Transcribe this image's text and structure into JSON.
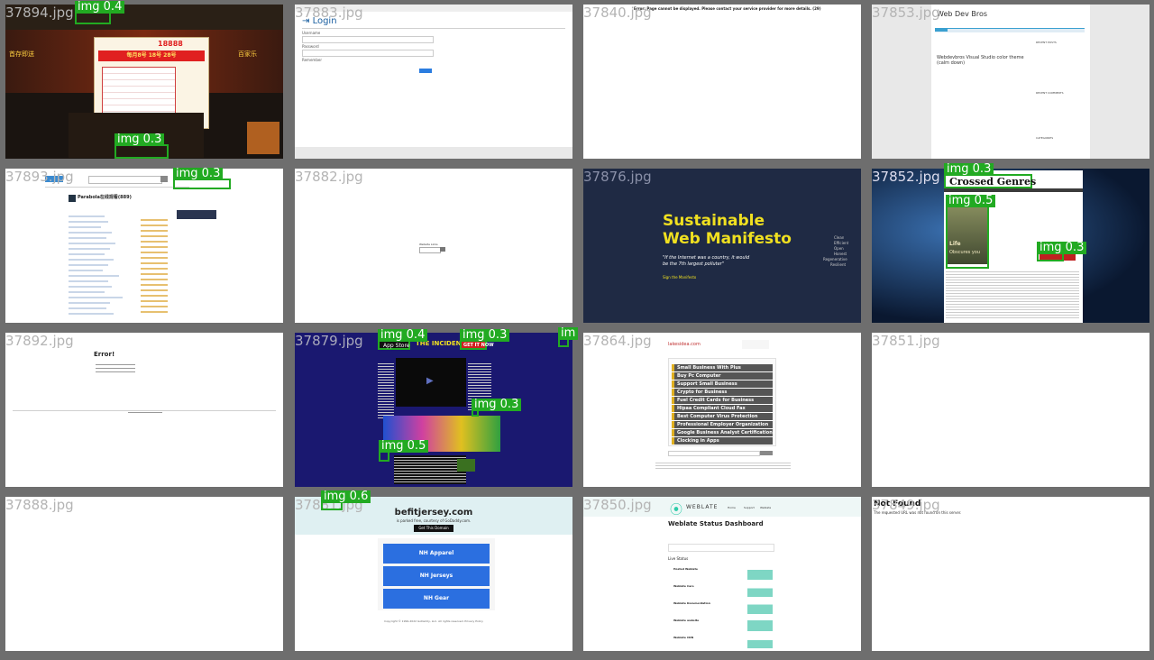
{
  "tiles": [
    {
      "filename": "37894.jpg",
      "detections": [
        {
          "label": "img 0.4"
        },
        {
          "label": "img 0.3"
        }
      ],
      "content": {
        "banner": "每月8号 18号 28号",
        "amount": "18888",
        "left_text": "首存即送",
        "right_text": "百家乐"
      }
    },
    {
      "filename": "37883.jpg",
      "detections": [],
      "content": {
        "title": "Login",
        "field1": "Username",
        "field2": "Password",
        "field3": "Remember"
      }
    },
    {
      "filename": "37840.jpg",
      "detections": [],
      "content": {
        "error": "Error: Page cannot be displayed. Please contact your service provider for more details. (29)"
      }
    },
    {
      "filename": "37853.jpg",
      "detections": [],
      "content": {
        "site_title": "Web Dev Bros",
        "post_title": "Webdevbros Visual Studio color theme (calm down)",
        "sidebar1": "RECENT POSTS",
        "sidebar2": "RECENT COMMENTS",
        "sidebar3": "CATEGORIES"
      }
    },
    {
      "filename": "37893.jpg",
      "detections": [
        {
          "label": "img 0.3"
        }
      ],
      "content": {
        "page_title": "Parabola在线观看(889)"
      }
    },
    {
      "filename": "37882.jpg",
      "detections": [],
      "content": {
        "box_label": "Website Links"
      }
    },
    {
      "filename": "37876.jpg",
      "detections": [],
      "content": {
        "headline_line1": "Sustainable",
        "headline_line2": "Web Manifesto",
        "quote": "\"If the Internet was a country, it would be the 7th largest polluter\"",
        "sign": "Sign the Manifesto",
        "list": [
          "Clean",
          "Efficient",
          "Open",
          "Honest",
          "Regenerative",
          "Resilient"
        ]
      }
    },
    {
      "filename": "37852.jpg",
      "detections": [
        {
          "label": "img 0.3"
        },
        {
          "label": "img 0.5"
        },
        {
          "label": "img 0.3"
        }
      ],
      "content": {
        "logo": "Crossed Genres",
        "book_line1": "Life",
        "book_line2": "Obscures you"
      }
    },
    {
      "filename": "37892.jpg",
      "detections": [],
      "content": {
        "title": "Error!"
      }
    },
    {
      "filename": "37879.jpg",
      "detections": [
        {
          "label": "img 0.4"
        },
        {
          "label": "img 0.3"
        },
        {
          "label": "im"
        },
        {
          "label": "img 0.3"
        },
        {
          "label": "img 0.5"
        }
      ],
      "content": {
        "app_store": "App Store",
        "incident": "THE INCIDENT",
        "get_it": "GET IT NOW"
      }
    },
    {
      "filename": "37864.jpg",
      "detections": [],
      "content": {
        "site": "lakesidea.com",
        "links": [
          "Small Business With Plus",
          "Buy Pc Computer",
          "Support Small Business",
          "Crypto for Business",
          "Fuel Credit Cards for Business",
          "Hipaa Compliant Cloud Fax",
          "Best Computer Virus Protection",
          "Professional Employer Organization",
          "Google Business Analyst Certification",
          "Clocking in Apps"
        ]
      }
    },
    {
      "filename": "37851.jpg",
      "detections": [],
      "content": {}
    },
    {
      "filename": "37888.jpg",
      "detections": [],
      "content": {}
    },
    {
      "filename": "37881.jpg",
      "detections": [
        {
          "label": "img 0.6"
        }
      ],
      "content": {
        "domain": "befitjersey.com",
        "parked": "is parked free, courtesy of GoDaddy.com.",
        "cta": "Get This Domain",
        "buttons": [
          "NH Apparel",
          "NH Jerseys",
          "NH Gear"
        ],
        "footer": "Copyright © 1999-2022 GoDaddy, LLC. All rights reserved. Privacy Policy"
      }
    },
    {
      "filename": "37850.jpg",
      "detections": [],
      "content": {
        "brand": "WEBLATE",
        "nav": [
          "Home",
          "Support",
          "Weblate"
        ],
        "heading": "Weblate Status Dashboard",
        "status_label": "Live Status",
        "services": [
          "Hosted Weblate",
          "Weblate Care",
          "Weblate Documentation",
          "Weblate website",
          "Weblate CDN"
        ]
      }
    },
    {
      "filename": "37849.jpg",
      "detections": [],
      "content": {
        "title": "Not Found",
        "text": "The requested URL was not found on this server."
      }
    }
  ]
}
